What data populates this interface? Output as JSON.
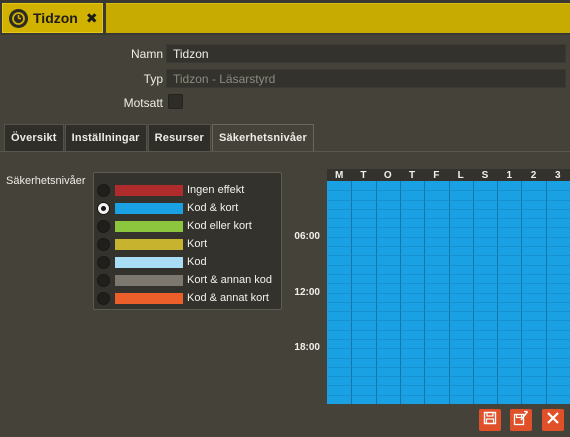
{
  "tab": {
    "title": "Tidzon"
  },
  "form": {
    "name_label": "Namn",
    "name_value": "Tidzon",
    "type_label": "Typ",
    "type_placeholder": "Tidzon - Läsarstyrd",
    "inverted_label": "Motsatt",
    "inverted_checked": false
  },
  "subtabs": [
    "Översikt",
    "Inställningar",
    "Resurser",
    "Säkerhetsnivåer"
  ],
  "active_subtab": "Säkerhetsnivåer",
  "security": {
    "label": "Säkerhetsnivåer",
    "levels": [
      {
        "label": "Ingen effekt",
        "color": "#b02b2b",
        "selected": false
      },
      {
        "label": "Kod & kort",
        "color": "#1aa1e4",
        "selected": true
      },
      {
        "label": "Kod eller kort",
        "color": "#8cc63f",
        "selected": false
      },
      {
        "label": "Kort",
        "color": "#c8b32e",
        "selected": false
      },
      {
        "label": "Kod",
        "color": "#a9ddf6",
        "selected": false
      },
      {
        "label": "Kort & annan kod",
        "color": "#7c786f",
        "selected": false
      },
      {
        "label": "Kod & annat kort",
        "color": "#ec5f2b",
        "selected": false
      }
    ]
  },
  "schedule": {
    "columns": [
      "M",
      "T",
      "O",
      "T",
      "F",
      "L",
      "S",
      "1",
      "2",
      "3"
    ],
    "times": [
      "06:00",
      "12:00",
      "18:00"
    ],
    "fill_color": "#1aa1e4"
  },
  "actions": {
    "save_icon": "save-icon",
    "save_as_icon": "save-as-icon",
    "close_icon": "close-icon"
  }
}
